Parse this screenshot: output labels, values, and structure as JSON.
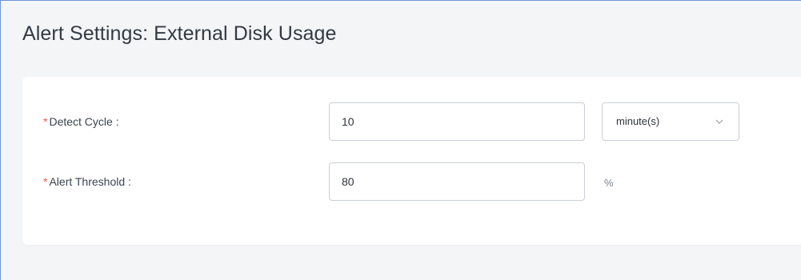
{
  "page": {
    "title": "Alert Settings: External Disk Usage"
  },
  "form": {
    "detect_cycle": {
      "required_mark": "*",
      "label": "Detect Cycle :",
      "value": "10",
      "unit_select": {
        "selected": "minute(s)",
        "icon": "chevron-down-icon"
      }
    },
    "alert_threshold": {
      "required_mark": "*",
      "label": "Alert Threshold :",
      "value": "80",
      "unit": "%"
    }
  },
  "colors": {
    "required": "#f05a4f",
    "frame_border": "#6d96d8",
    "page_background": "#f4f5f7",
    "input_border": "#c9ced6"
  }
}
